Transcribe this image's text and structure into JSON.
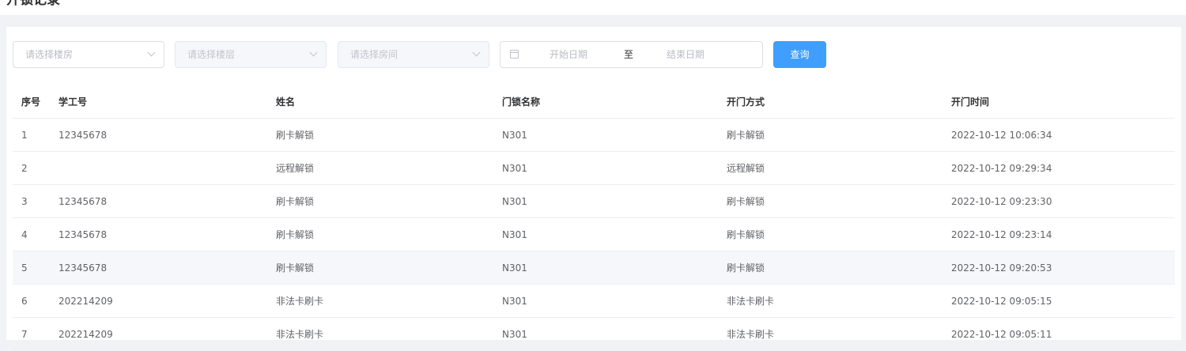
{
  "header": {
    "title": "开锁记录"
  },
  "filters": {
    "building_placeholder": "请选择楼房",
    "floor_placeholder": "请选择楼层",
    "room_placeholder": "请选择房间",
    "start_placeholder": "开始日期",
    "range_separator": "至",
    "end_placeholder": "结束日期",
    "query_label": "查询"
  },
  "table": {
    "columns": [
      "序号",
      "学工号",
      "姓名",
      "门锁名称",
      "开门方式",
      "开门时间"
    ],
    "rows": [
      {
        "no": "1",
        "id": "12345678",
        "name": "刷卡解锁",
        "lock": "N301",
        "method": "刷卡解锁",
        "time": "2022-10-12 10:06:34"
      },
      {
        "no": "2",
        "id": "",
        "name": "远程解锁",
        "lock": "N301",
        "method": "远程解锁",
        "time": "2022-10-12 09:29:34"
      },
      {
        "no": "3",
        "id": "12345678",
        "name": "刷卡解锁",
        "lock": "N301",
        "method": "刷卡解锁",
        "time": "2022-10-12 09:23:30"
      },
      {
        "no": "4",
        "id": "12345678",
        "name": "刷卡解锁",
        "lock": "N301",
        "method": "刷卡解锁",
        "time": "2022-10-12 09:23:14"
      },
      {
        "no": "5",
        "id": "12345678",
        "name": "刷卡解锁",
        "lock": "N301",
        "method": "刷卡解锁",
        "time": "2022-10-12 09:20:53"
      },
      {
        "no": "6",
        "id": "202214209",
        "name": "非法卡刷卡",
        "lock": "N301",
        "method": "非法卡刷卡",
        "time": "2022-10-12 09:05:15"
      },
      {
        "no": "7",
        "id": "202214209",
        "name": "非法卡刷卡",
        "lock": "N301",
        "method": "非法卡刷卡",
        "time": "2022-10-12 09:05:11"
      }
    ]
  },
  "colors": {
    "primary": "#409eff",
    "header_text": "#303133",
    "cell_text": "#606266",
    "hover_row": "#f5f7fa"
  }
}
